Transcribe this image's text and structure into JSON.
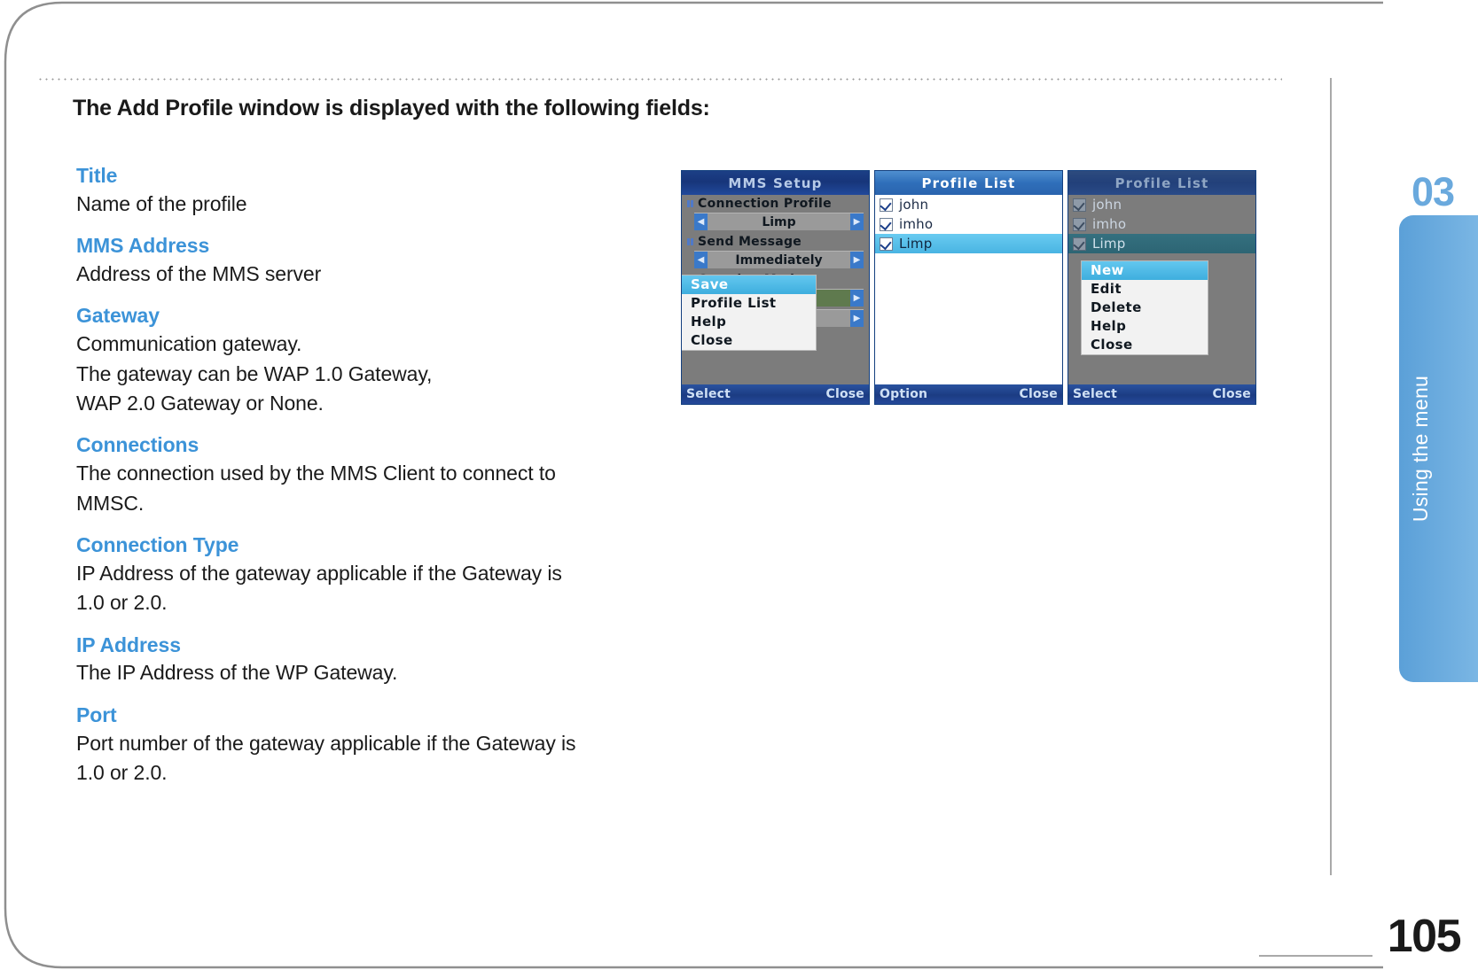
{
  "document": {
    "heading": "The Add Profile window is displayed with the following fields:",
    "page_number": "105",
    "chapter_number": "03",
    "chapter_label": "Using the menu"
  },
  "fields": [
    {
      "term": "Title",
      "desc": "Name of the profile"
    },
    {
      "term": "MMS Address",
      "desc": "Address of the MMS server"
    },
    {
      "term": "Gateway",
      "desc": "Communication gateway.\nThe gateway can be WAP 1.0 Gateway,\nWAP 2.0 Gateway or None."
    },
    {
      "term": "Connections",
      "desc": "The connection used by the MMS Client to connect to\nMMSC."
    },
    {
      "term": "Connection Type",
      "desc": "IP Address of the gateway applicable if the Gateway is\n1.0 or 2.0."
    },
    {
      "term": "IP Address",
      "desc": "The IP Address of the WP Gateway."
    },
    {
      "term": "Port",
      "desc": "Port number of the gateway applicable if the Gateway is\n1.0 or 2.0."
    }
  ],
  "screenshots": [
    {
      "title": "MMS  Setup",
      "rows": [
        {
          "label": "Connection  Profile",
          "value": "Limp"
        },
        {
          "label": "Send  Message",
          "value": "Immediately"
        },
        {
          "label": "Creation  Mode",
          "value": ""
        }
      ],
      "menu": [
        "Save",
        "Profile  List",
        "Help",
        "Close"
      ],
      "menu_selected": "Save",
      "softkey_left": "Select",
      "softkey_right": "Close"
    },
    {
      "title": "Profile  List",
      "items": [
        "john",
        "imho",
        "Limp"
      ],
      "selected": "Limp",
      "softkey_left": "Option",
      "softkey_right": "Close"
    },
    {
      "title": "Profile  List",
      "items": [
        "john",
        "imho",
        "Limp"
      ],
      "selected": "Limp",
      "menu": [
        "New",
        "Edit",
        "Delete",
        "Help",
        "Close"
      ],
      "menu_selected": "New",
      "softkey_left": "Select",
      "softkey_right": "Close"
    }
  ],
  "colors": {
    "accent_term": "#3c93d8",
    "tab_blue": "#5ba0d8",
    "title_bar": "#1c3f86",
    "highlight": "#49b4e2"
  }
}
